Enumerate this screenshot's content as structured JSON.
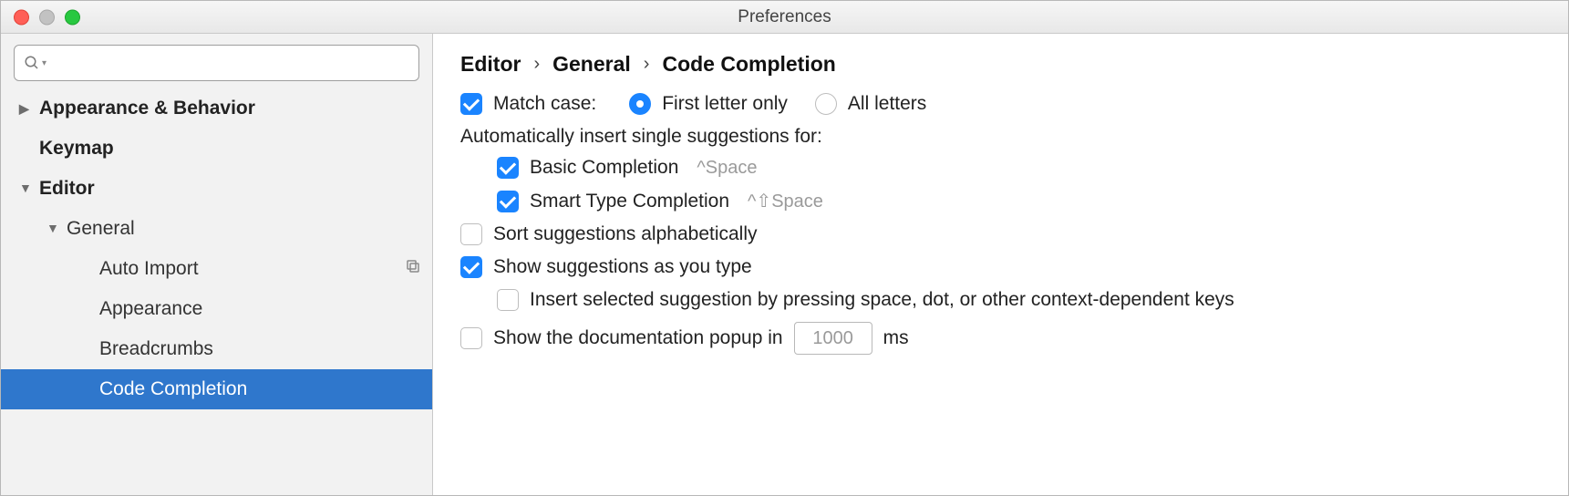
{
  "window": {
    "title": "Preferences"
  },
  "sidebar": {
    "search_placeholder": "",
    "items": [
      {
        "label": "Appearance & Behavior",
        "bold": true,
        "arrow": "right"
      },
      {
        "label": "Keymap",
        "bold": true,
        "arrow": ""
      },
      {
        "label": "Editor",
        "bold": true,
        "arrow": "down"
      },
      {
        "label": "General",
        "arrow": "down"
      },
      {
        "label": "Auto Import",
        "copy": true
      },
      {
        "label": "Appearance"
      },
      {
        "label": "Breadcrumbs"
      },
      {
        "label": "Code Completion",
        "selected": true
      }
    ]
  },
  "breadcrumb": {
    "a": "Editor",
    "b": "General",
    "c": "Code Completion",
    "sep": "›"
  },
  "settings": {
    "match_case": {
      "label": "Match case:",
      "checked": true
    },
    "radio_first": {
      "label": "First letter only",
      "selected": true
    },
    "radio_all": {
      "label": "All letters",
      "selected": false
    },
    "auto_insert_heading": "Automatically insert single suggestions for:",
    "basic": {
      "label": "Basic Completion",
      "shortcut": "^Space",
      "checked": true
    },
    "smart": {
      "label": "Smart Type Completion",
      "shortcut": "^⇧Space",
      "checked": true
    },
    "sort_alpha": {
      "label": "Sort suggestions alphabetically",
      "checked": false
    },
    "show_as_type": {
      "label": "Show suggestions as you type",
      "checked": true
    },
    "insert_by_keys": {
      "label": "Insert selected suggestion by pressing space, dot, or other context-dependent keys",
      "checked": false
    },
    "doc_popup": {
      "label_before": "Show the documentation popup in",
      "label_after": "ms",
      "value": "1000",
      "checked": false
    }
  }
}
